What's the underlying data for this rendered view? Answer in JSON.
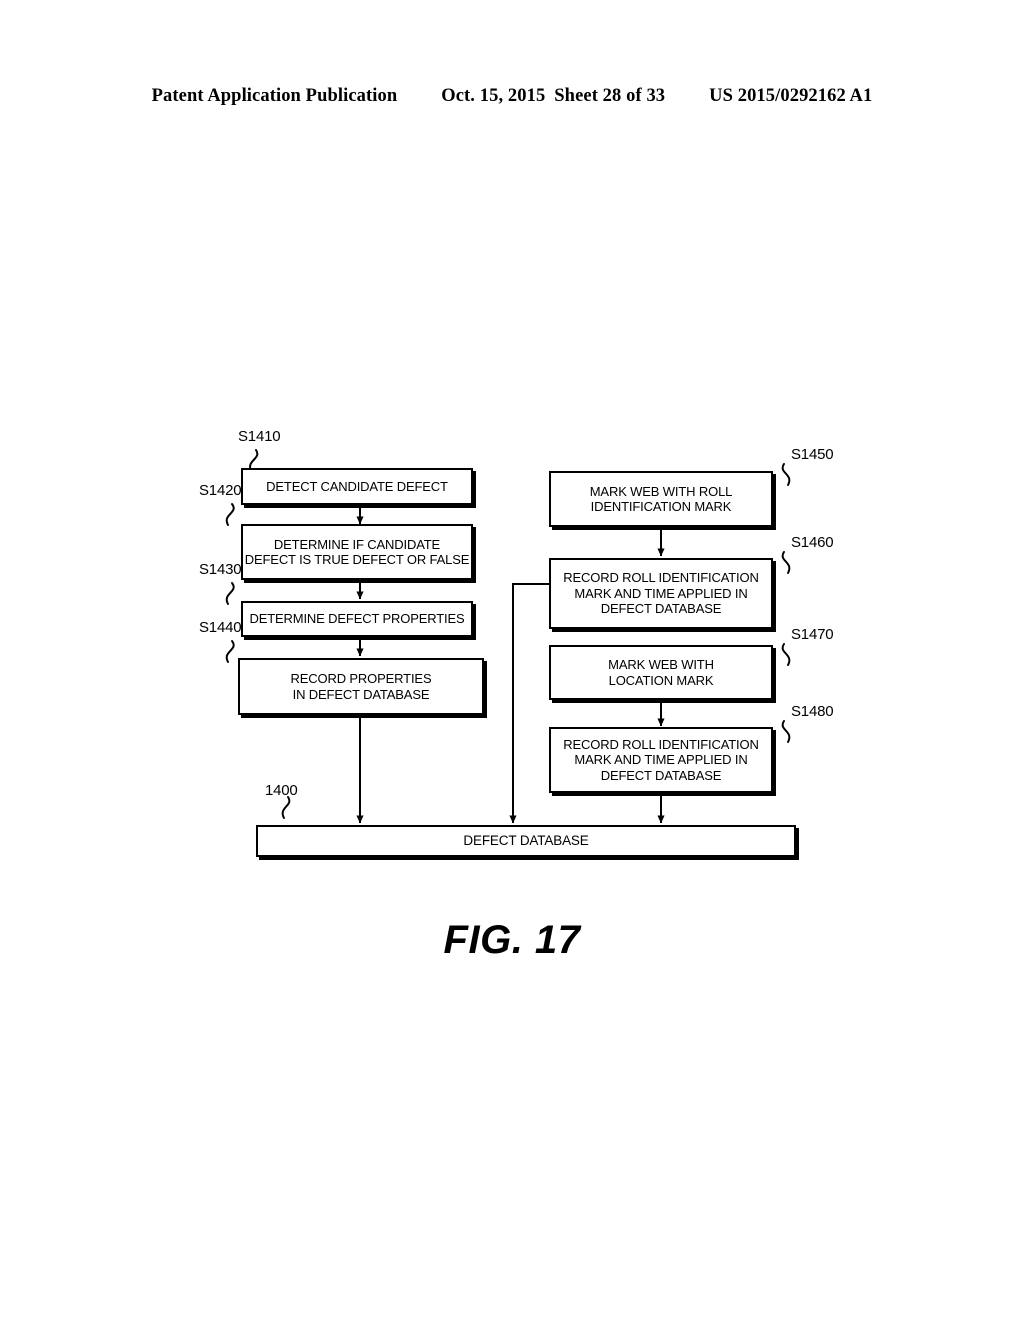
{
  "header": {
    "publication": "Patent Application Publication",
    "date": "Oct. 15, 2015",
    "sheet": "Sheet 28 of 33",
    "patent_number": "US 2015/0292162 A1"
  },
  "figure": {
    "caption": "FIG. 17",
    "boxes": {
      "s1410": {
        "ref": "S1410",
        "text": "DETECT CANDIDATE DEFECT"
      },
      "s1420": {
        "ref": "S1420",
        "text": "DETERMINE IF CANDIDATE\nDEFECT IS TRUE DEFECT OR FALSE"
      },
      "s1430": {
        "ref": "S1430",
        "text": "DETERMINE DEFECT PROPERTIES"
      },
      "s1440": {
        "ref": "S1440",
        "text": "RECORD PROPERTIES\nIN DEFECT DATABASE"
      },
      "s1450": {
        "ref": "S1450",
        "text": "MARK WEB WITH ROLL\nIDENTIFICATION MARK"
      },
      "s1460": {
        "ref": "S1460",
        "text": "RECORD ROLL IDENTIFICATION\nMARK AND TIME APPLIED IN\nDEFECT DATABASE"
      },
      "s1470": {
        "ref": "S1470",
        "text": "MARK WEB WITH\nLOCATION MARK"
      },
      "s1480": {
        "ref": "S1480",
        "text": "RECORD ROLL IDENTIFICATION\nMARK AND TIME APPLIED IN\nDEFECT  DATABASE"
      },
      "database": {
        "ref": "1400",
        "text": "DEFECT DATABASE"
      }
    }
  },
  "colors": {
    "ink": "#000000",
    "paper": "#ffffff"
  }
}
